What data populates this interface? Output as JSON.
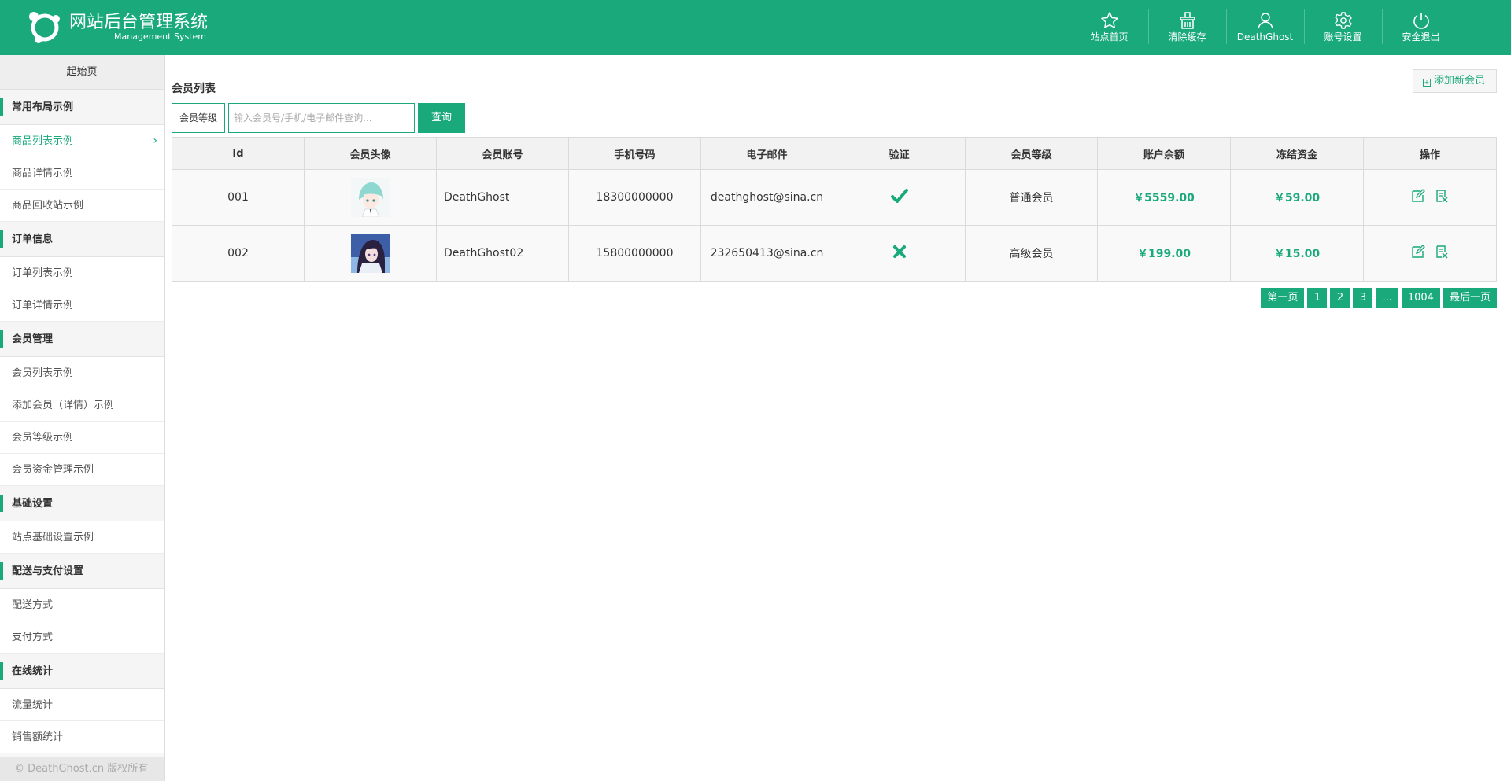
{
  "app": {
    "title": "网站后台管理系统",
    "subtitle": "Management System"
  },
  "nav": [
    {
      "label": "站点首页",
      "icon": "star-icon"
    },
    {
      "label": "清除缓存",
      "icon": "basket-icon"
    },
    {
      "label": "DeathGhost",
      "icon": "user-icon"
    },
    {
      "label": "账号设置",
      "icon": "gear-icon"
    },
    {
      "label": "安全退出",
      "icon": "power-icon"
    }
  ],
  "sidebar": {
    "home": "起始页",
    "groups": [
      {
        "title": "常用布局示例",
        "items": [
          "商品列表示例",
          "商品详情示例",
          "商品回收站示例"
        ]
      },
      {
        "title": "订单信息",
        "items": [
          "订单列表示例",
          "订单详情示例"
        ]
      },
      {
        "title": "会员管理",
        "items": [
          "会员列表示例",
          "添加会员（详情）示例",
          "会员等级示例",
          "会员资金管理示例"
        ]
      },
      {
        "title": "基础设置",
        "items": [
          "站点基础设置示例"
        ]
      },
      {
        "title": "配送与支付设置",
        "items": [
          "配送方式",
          "支付方式"
        ]
      },
      {
        "title": "在线统计",
        "items": [
          "流量统计",
          "销售额统计"
        ]
      }
    ],
    "active_item": "商品列表示例",
    "footer": "© DeathGhost.cn 版权所有"
  },
  "main": {
    "title": "会员列表",
    "add_label": "添加新会员",
    "filter_label": "会员等级",
    "search_placeholder": "输入会员号/手机/电子邮件查询...",
    "search_button": "查询",
    "columns": [
      "Id",
      "会员头像",
      "会员账号",
      "手机号码",
      "电子邮件",
      "验证",
      "会员等级",
      "账户余额",
      "冻结资金",
      "操作"
    ],
    "rows": [
      {
        "id": "001",
        "account": "DeathGhost",
        "phone": "18300000000",
        "email": "deathghost@sina.cn",
        "verified": true,
        "level": "普通会员",
        "balance": "￥5559.00",
        "frozen": "￥59.00"
      },
      {
        "id": "002",
        "account": "DeathGhost02",
        "phone": "15800000000",
        "email": "232650413@sina.cn",
        "verified": false,
        "level": "高级会员",
        "balance": "￥199.00",
        "frozen": "￥15.00"
      }
    ],
    "pager": [
      "第一页",
      "1",
      "2",
      "3",
      "...",
      "1004",
      "最后一页"
    ]
  },
  "colors": {
    "accent": "#19a97b"
  }
}
